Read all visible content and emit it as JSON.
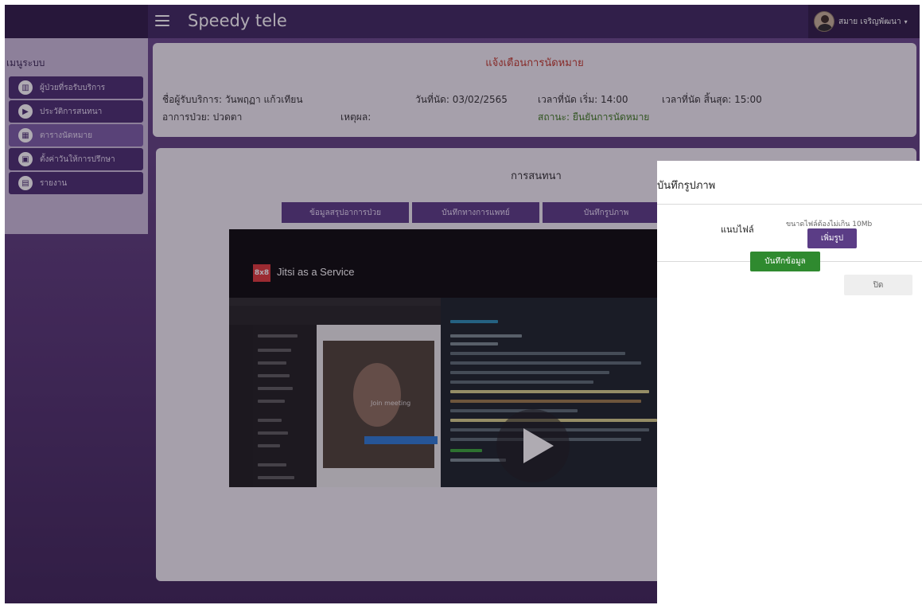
{
  "app": {
    "title": "Speedy tele",
    "user_name": "สมาย เจริญพัฒนา",
    "user_caret": "▾"
  },
  "sidebar": {
    "heading": "เมนูระบบ",
    "items": [
      {
        "label": "ผู้ป่วยที่รอรับบริการ",
        "icon": "table-icon",
        "glyph": "▥",
        "active": false
      },
      {
        "label": "ประวัติการสนทนา",
        "icon": "video-icon",
        "glyph": "▶",
        "active": false
      },
      {
        "label": "ตารางนัดหมาย",
        "icon": "calendar-grid-icon",
        "glyph": "▦",
        "active": true
      },
      {
        "label": "ตั้งค่าวันให้การปรึกษา",
        "icon": "calendar-icon",
        "glyph": "▣",
        "active": false
      },
      {
        "label": "รายงาน",
        "icon": "document-icon",
        "glyph": "▤",
        "active": false
      }
    ]
  },
  "appointment": {
    "title": "แจ้งเตือนการนัดหมาย",
    "patient": "ชื่อผู้รับบริการ: วันพฤฏา แก้วเทียน",
    "date": "วันที่นัด: 03/02/2565",
    "start_time": "เวลาที่นัด เริ่ม: 14:00",
    "end_time": "เวลาที่นัด สิ้นสุด: 15:00",
    "symptom": "อาการป่วย: ปวดตา",
    "reason": "เหตุผล:",
    "status": "สถานะ: ยืนยันการนัดหมาย"
  },
  "chat": {
    "title": "การสนทนา",
    "tabs": [
      "ข้อมูลสรุปอาการป่วย",
      "บันทึกทางการแพทย์",
      "บันทึกรูปภาพ"
    ],
    "video": {
      "logo_text": "8x8",
      "title": "Jitsi as a Service",
      "join_text": "Join meeting"
    }
  },
  "modal": {
    "title": "บันทึกรูปภาพ",
    "file_label": "แนบไฟล์",
    "file_hint": "ขนาดไฟล์ต้องไม่เกิน 10Mb",
    "attach_button": "เพิ่มรูป",
    "save_button": "บันทึกข้อมูล",
    "close_button": "ปิด"
  },
  "colors": {
    "brand_purple": "#5b3d86",
    "sidebar_bg": "#cbbddb",
    "alert_red": "#c0392b",
    "status_green": "#3c7a1e",
    "save_green": "#2f8a2f"
  }
}
